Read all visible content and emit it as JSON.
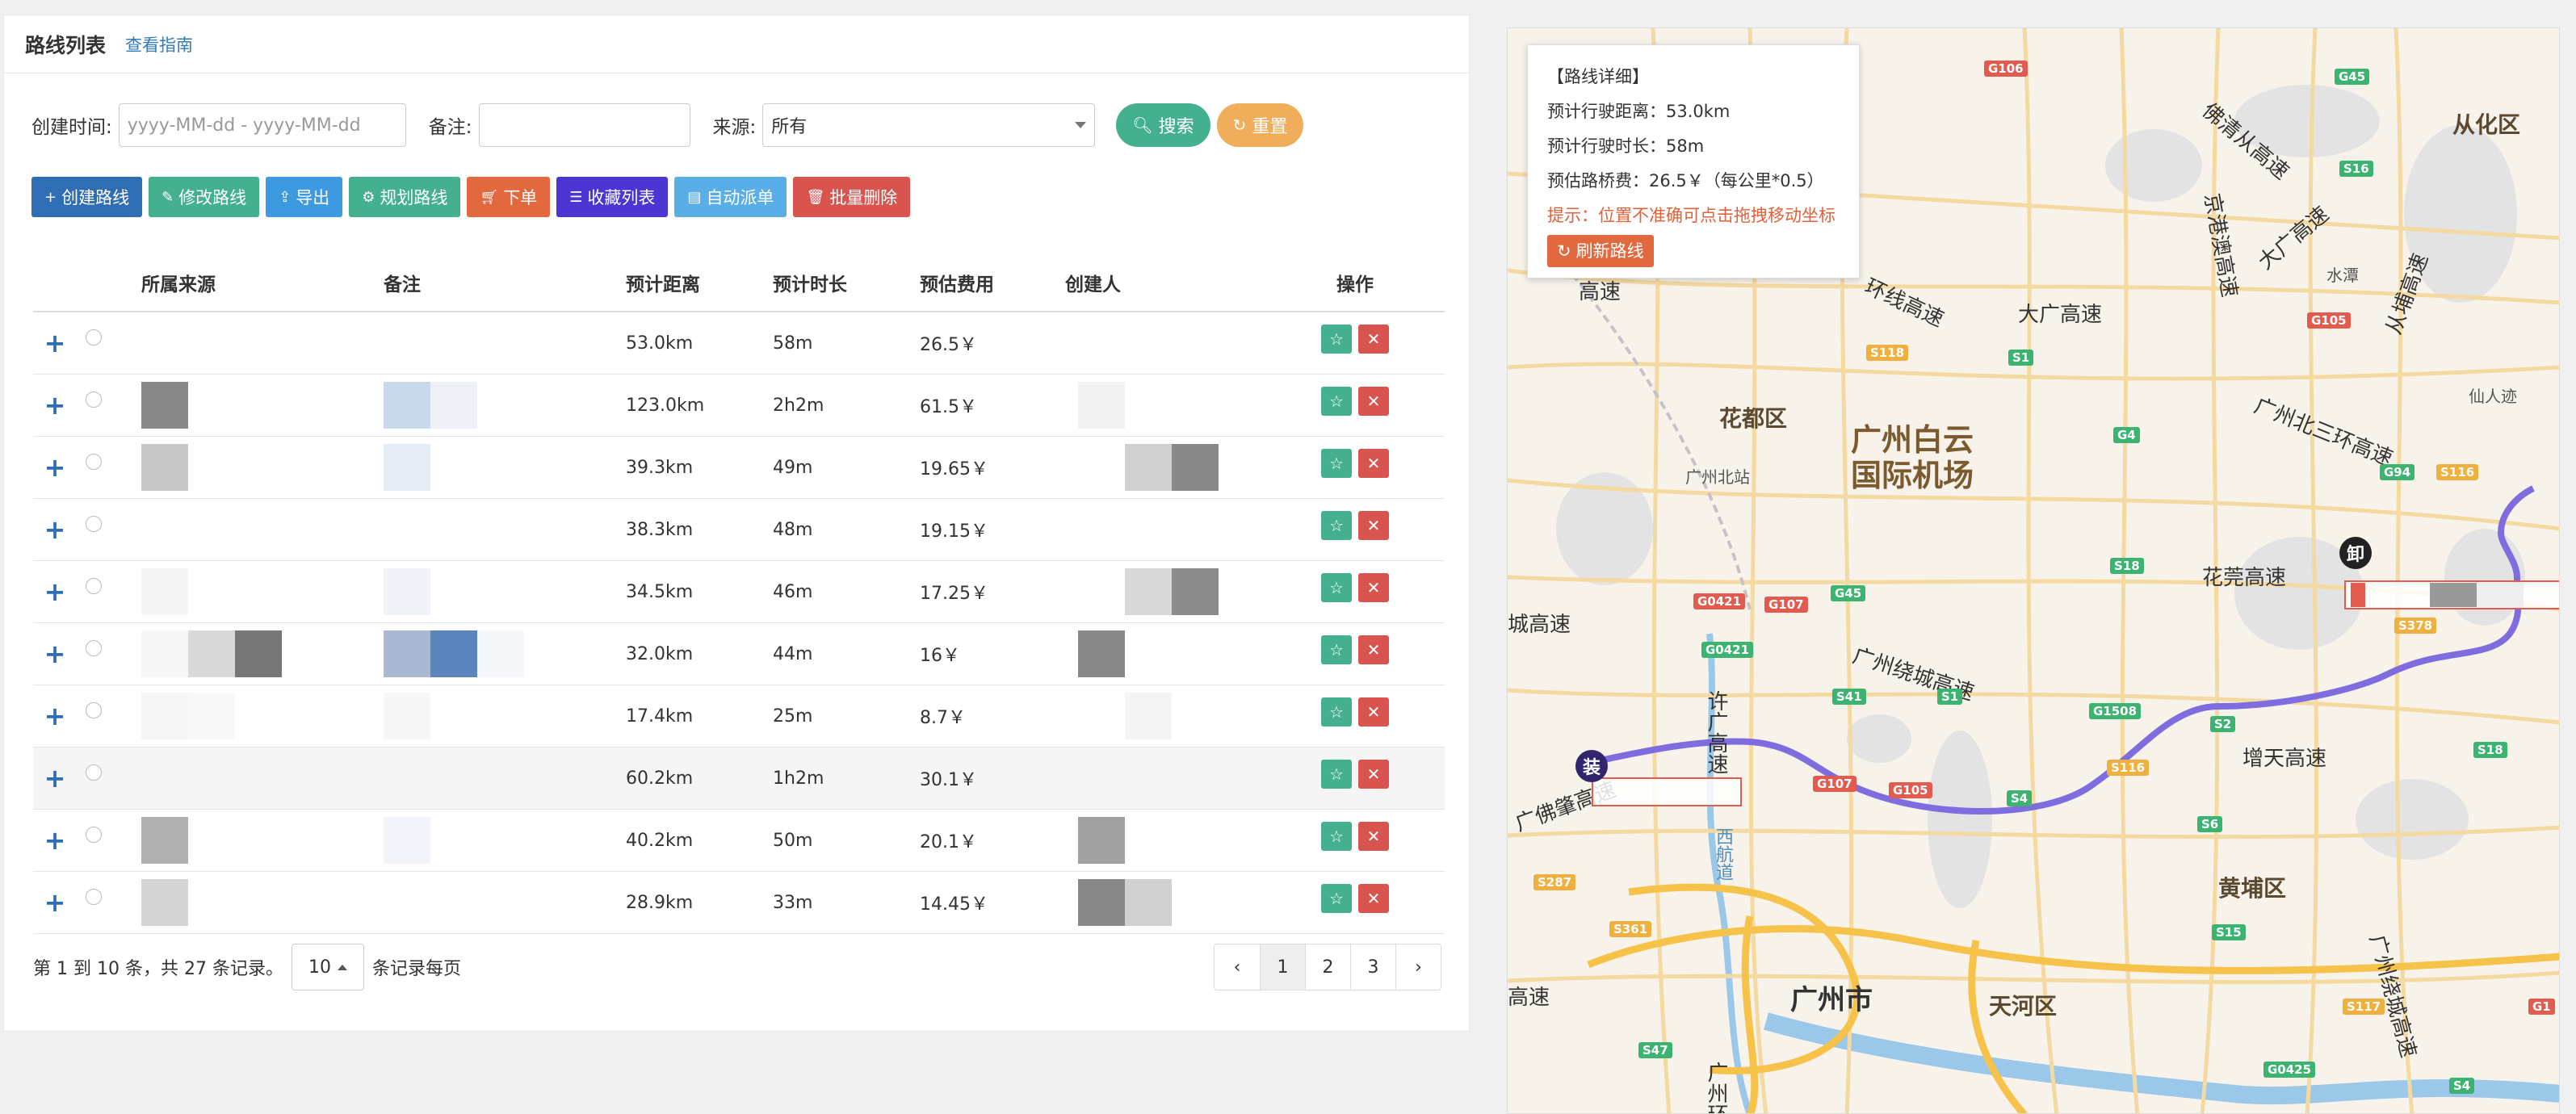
{
  "panel": {
    "title": "路线列表",
    "guide_link": "查看指南"
  },
  "filters": {
    "created_label": "创建时间:",
    "date_placeholder": "yyyy-MM-dd - yyyy-MM-dd",
    "remark_label": "备注:",
    "source_label": "来源:",
    "source_value": "所有",
    "search_label": "搜索",
    "reset_label": "重置"
  },
  "toolbar": [
    {
      "label": "创建路线",
      "icon": "plus-icon",
      "color": "#2f6db5"
    },
    {
      "label": "修改路线",
      "icon": "edit-icon",
      "color": "#44b08f"
    },
    {
      "label": "导出",
      "icon": "export-icon",
      "color": "#3d9ae0"
    },
    {
      "label": "规划路线",
      "icon": "cogs-icon",
      "color": "#44b08f"
    },
    {
      "label": "下单",
      "icon": "cart-icon",
      "color": "#e2693e"
    },
    {
      "label": "收藏列表",
      "icon": "list-icon",
      "color": "#4b36d4"
    },
    {
      "label": "自动派单",
      "icon": "dispatch-icon",
      "color": "#5aaee8"
    },
    {
      "label": "批量删除",
      "icon": "trash-icon",
      "color": "#d9534f"
    }
  ],
  "table": {
    "columns": [
      "所属来源",
      "备注",
      "预计距离",
      "预计时长",
      "预估费用",
      "创建人",
      "操作"
    ],
    "rows": [
      {
        "distance": "53.0km",
        "duration": "58m",
        "fee": "26.5￥"
      },
      {
        "distance": "123.0km",
        "duration": "2h2m",
        "fee": "61.5￥"
      },
      {
        "distance": "39.3km",
        "duration": "49m",
        "fee": "19.65￥"
      },
      {
        "distance": "38.3km",
        "duration": "48m",
        "fee": "19.15￥"
      },
      {
        "distance": "34.5km",
        "duration": "46m",
        "fee": "17.25￥"
      },
      {
        "distance": "32.0km",
        "duration": "44m",
        "fee": "16￥"
      },
      {
        "distance": "17.4km",
        "duration": "25m",
        "fee": "8.7￥"
      },
      {
        "distance": "60.2km",
        "duration": "1h2m",
        "fee": "30.1￥"
      },
      {
        "distance": "40.2km",
        "duration": "50m",
        "fee": "20.1￥"
      },
      {
        "distance": "28.9km",
        "duration": "33m",
        "fee": "14.45￥"
      }
    ]
  },
  "pager": {
    "info": "第 1 到 10 条，共 27 条记录。",
    "page_size": "10",
    "per_page_label": "条记录每页",
    "prev": "‹",
    "pages": [
      "1",
      "2",
      "3"
    ],
    "next": "›"
  },
  "popup": {
    "title": "【路线详细】",
    "distance": "预计行驶距离：53.0km",
    "duration": "预计行驶时长：58m",
    "fee": "预估路桥费：26.5￥（每公里*0.5）",
    "tip": "提示：位置不准确可点击拖拽移动坐标",
    "refresh": "刷新路线"
  },
  "map": {
    "load_marker": "装",
    "unload_marker": "卸",
    "labels": {
      "airport": "广州白云\n国际机场",
      "huadu": "花都区",
      "guangzhou_north": "广州北站",
      "conghua": "从化区",
      "baiyun_gz": "广州市",
      "tianhe": "天河区",
      "huangpu": "黄埔区",
      "daguang": "大广高速",
      "huaguan": "花莞高速",
      "zengtian": "增天高速",
      "raocheng": "广州绕城高速",
      "beisan": "广州北三环高速",
      "fokai": "佛清从高速",
      "jinggang": "京港澳高速",
      "daguang2": "大广高速",
      "congdu": "从埔高速",
      "guangfozhao": "广佛肇高速",
      "xu": "许广高速",
      "xihang": "西航道",
      "huanshi": "环线高速",
      "chenggao": "城高速",
      "gaosu_left": "高速",
      "shui": "水潭",
      "xianren": "仙人迹",
      "raocheng2": "广州绕城高速",
      "huancheng": "广州环城",
      "su": "高速"
    }
  }
}
